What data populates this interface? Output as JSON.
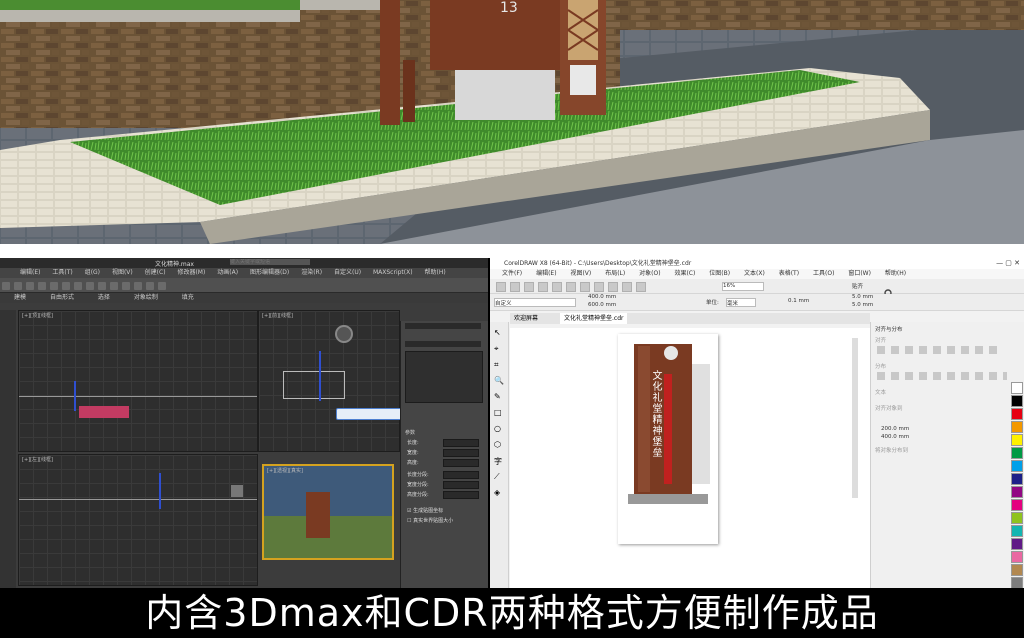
{
  "max_window": {
    "title": "文化精神.max",
    "search_placeholder": "键入关键字或短语",
    "menu": [
      "编辑(E)",
      "工具(T)",
      "组(G)",
      "视图(V)",
      "创建(C)",
      "修改器(M)",
      "动画(A)",
      "图形编辑器(D)",
      "渲染(R)",
      "自定义(U)",
      "MAXScript(X)",
      "帮助(H)"
    ],
    "subbar": [
      "建模",
      "自由形式",
      "选择",
      "对象绘制",
      "填充"
    ],
    "viewports": [
      "[+][顶][线框]",
      "[+][前][线框]",
      "[+][左][线框]",
      "[+][透视][真实]"
    ],
    "panel_label": "参数",
    "panel_rows": [
      "长度:",
      "宽度:",
      "高度:",
      "长度分段:",
      "宽度分段:",
      "高度分段:"
    ],
    "panel_checks": [
      "生成贴图坐标",
      "真实世界贴图大小"
    ]
  },
  "cdr_window": {
    "title": "CorelDRAW X8 (64-Bit) - C:\\Users\\Desktop\\文化礼堂精神堡垒.cdr",
    "menu": [
      "文件(F)",
      "编辑(E)",
      "视图(V)",
      "布局(L)",
      "对象(O)",
      "效果(C)",
      "位图(B)",
      "文本(X)",
      "表格(T)",
      "工具(O)",
      "窗口(W)",
      "帮助(H)"
    ],
    "preset": "自定义",
    "width_mm": "400.0 mm",
    "height_mm": "600.0 mm",
    "zoom": "16%",
    "unit_label": "单位:",
    "unit": "毫米",
    "nudge": "0.1 mm",
    "dup_x": "5.0 mm",
    "dup_y": "5.0 mm",
    "snap": "贴齐",
    "tabs": [
      "欢迎屏幕",
      "文化礼堂精神堡垒.cdr"
    ],
    "sign_text": "文化礼堂精神堡垒",
    "panel_title": "对齐与分布",
    "panel_sections": [
      "对齐",
      "分布",
      "文本",
      "对齐对象到",
      "将对象分布到"
    ],
    "panel_w": "200.0 mm",
    "panel_h": "400.0 mm",
    "palette": [
      "#ffffff",
      "#000000",
      "#e60012",
      "#f39800",
      "#fff100",
      "#009944",
      "#00a0e9",
      "#1d2088",
      "#920783",
      "#e4007f",
      "#8fc31f",
      "#13b5b1",
      "#601986",
      "#ea68a2",
      "#b28850",
      "#7d7d7d"
    ]
  },
  "caption": "内含3Dmax和CDR两种格式方便制作成品",
  "colors": {
    "sign_brown": "#7a3a22",
    "accent_red": "#c0211f"
  }
}
